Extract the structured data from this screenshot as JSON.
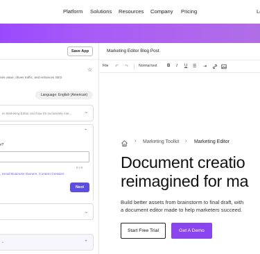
{
  "nav": {
    "items": [
      "Platform",
      "Solutions",
      "Resources",
      "Company",
      "Pricing",
      "Lo"
    ]
  },
  "left_panel": {
    "save_app": "Save App",
    "description": "nes value, drives traffic, and enhances SEO",
    "language": "Language: English (American)",
    "card1_text": "er Marketing Editor and how it's exclusively mar...",
    "question": "e?",
    "char_count": "0 / 6",
    "tags": ", Small Business Owners, Content Creators",
    "next": "Next"
  },
  "editor": {
    "title": "Marketing Editor Blog Post",
    "toolbar": {
      "file": "File",
      "normal_text": "Normal text",
      "bold": "B",
      "italic": "I",
      "underline": "U"
    }
  },
  "hero": {
    "breadcrumb_1": "Marketing Toolkit",
    "breadcrumb_2": "Marketing Editor",
    "headline_line1": "Document creatio",
    "headline_line2": "reimagined for ma",
    "subtext_line1": "Build better assets from brainstorm to final draft, with",
    "subtext_line2": "a document editor made to help marketers succeed.",
    "cta_trial": "Start Free Trial",
    "cta_demo": "Get A Demo"
  },
  "colors": {
    "banner": "#9a49ff",
    "accent": "#5b4de6",
    "demo_button": "#8b45ef"
  }
}
